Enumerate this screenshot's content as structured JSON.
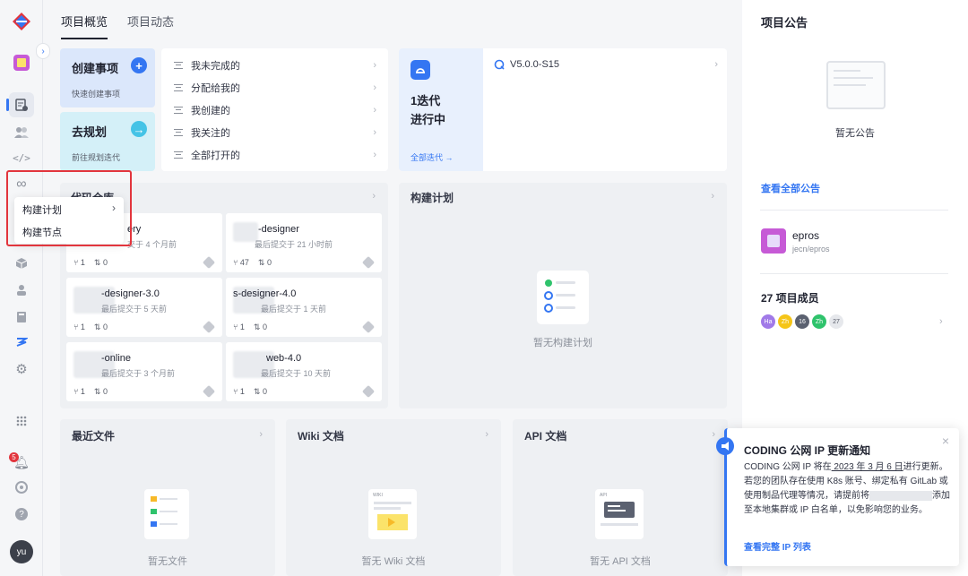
{
  "tabs": [
    {
      "label": "项目概览"
    },
    {
      "label": "项目动态"
    }
  ],
  "quick": {
    "create_title": "创建事项",
    "create_sub": "快速创建事项",
    "create_icon": "+",
    "plan_title": "去规划",
    "plan_sub": "前往规划迭代",
    "plan_icon": "→"
  },
  "filters": [
    "我未完成的",
    "分配给我的",
    "我创建的",
    "我关注的",
    "全部打开的"
  ],
  "iteration": {
    "count_line1": "1迭代",
    "count_line2": "进行中",
    "all_link": "全部迭代 →",
    "item": "V5.0.0-S15"
  },
  "repos": {
    "title": "代码仓库",
    "items": [
      {
        "name": "ery",
        "sub": "交于 4 个月前",
        "branches": "1",
        "mrs": "0"
      },
      {
        "name": "-designer",
        "sub": "最后提交于 21 小时前",
        "branches": "47",
        "mrs": "0"
      },
      {
        "name": "-designer-3.0",
        "sub": "最后提交于 5 天前",
        "branches": "1",
        "mrs": "0"
      },
      {
        "name": "s-designer-4.0",
        "sub": "最后提交于 1 天前",
        "branches": "1",
        "mrs": "0"
      },
      {
        "name": "-online",
        "sub": "最后提交于 3 个月前",
        "branches": "1",
        "mrs": "0"
      },
      {
        "name": "web-4.0",
        "sub": "最后提交于 10 天前",
        "branches": "1",
        "mrs": "0"
      }
    ]
  },
  "build": {
    "title": "构建计划",
    "empty": "暂无构建计划"
  },
  "menu": {
    "item1": "构建计划",
    "item1_chev": "›",
    "item2": "构建节点"
  },
  "files": {
    "title": "最近文件",
    "empty": "暂无文件"
  },
  "wiki": {
    "title": "Wiki 文档",
    "empty": "暂无 Wiki 文档",
    "tag": "WIKI"
  },
  "api": {
    "title": "API 文档",
    "empty": "暂无 API 文档",
    "tag": "API"
  },
  "announce": {
    "title": "项目公告",
    "empty": "暂无公告",
    "view_all": "查看全部公告"
  },
  "project": {
    "name": "epros",
    "path": "jecn/epros"
  },
  "members": {
    "title": "27 项目成员",
    "avatars": [
      {
        "text": "Ha",
        "color": "#a17ae8"
      },
      {
        "text": "Zh",
        "color": "#f5c518"
      },
      {
        "text": "16",
        "color": "#5b6170"
      },
      {
        "text": "Zh",
        "color": "#2fc36c"
      },
      {
        "text": "27",
        "color": "#e6e8ec"
      }
    ]
  },
  "sidebar": {
    "badge": "5",
    "user": "yu"
  },
  "notification": {
    "title": "CODING 公网 IP 更新通知",
    "p1": "CODING 公网 IP 将在",
    "date": " 2023 年 3 月 6 日",
    "p2": "进行更新。若您的团队存在使用 K8s 账号、绑定私有 GitLab 或使用制品代理等情况，请提前将",
    "p3": "添加至本地集群或 IP 白名单，以免影响您的业务。",
    "link": "查看完整 IP 列表",
    "close": "×"
  },
  "colors": {
    "accent": "#3476f2",
    "highlight": "#e2353d",
    "badge": "#e2353d",
    "cyan_btn": "#45c3e6"
  }
}
